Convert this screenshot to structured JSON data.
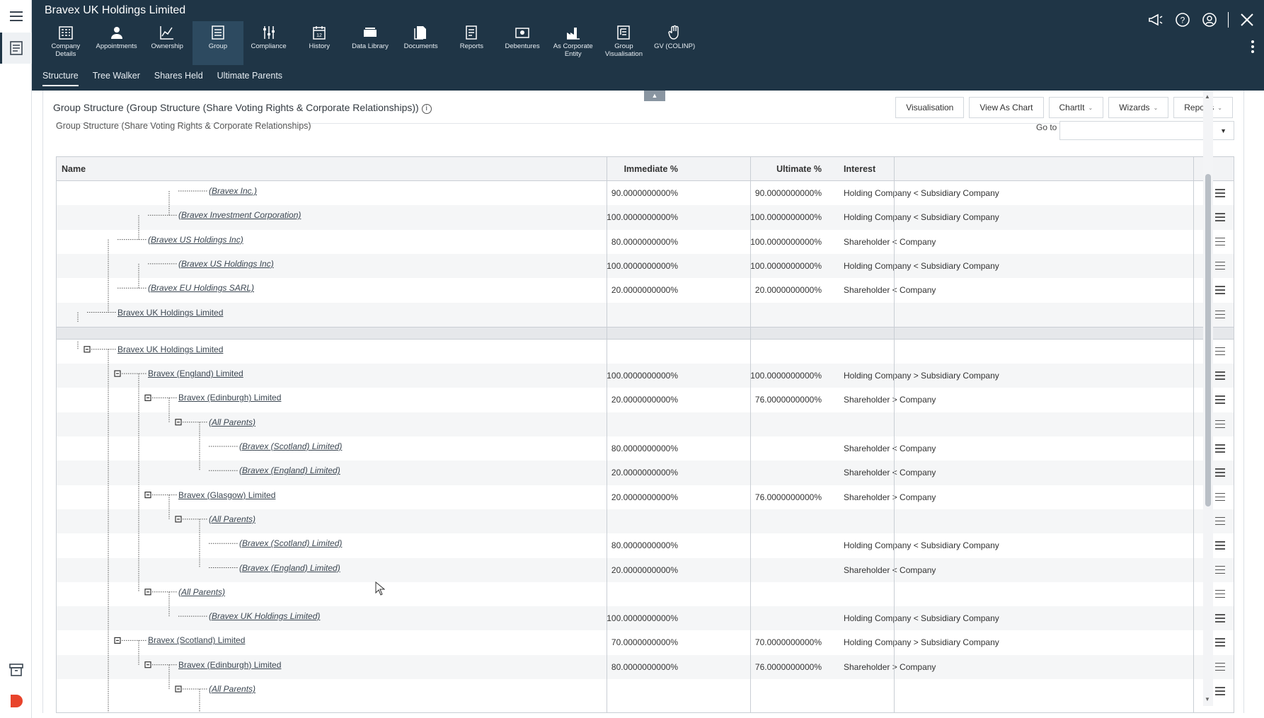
{
  "header": {
    "title": "Bravex UK Holdings Limited"
  },
  "toolbar": [
    {
      "label": "Company Details",
      "icon": "company-details-icon"
    },
    {
      "label": "Appointments",
      "icon": "appointments-icon"
    },
    {
      "label": "Ownership",
      "icon": "ownership-icon"
    },
    {
      "label": "Group",
      "icon": "group-icon",
      "active": true
    },
    {
      "label": "Compliance",
      "icon": "compliance-icon"
    },
    {
      "label": "History",
      "icon": "history-icon"
    },
    {
      "label": "Data Library",
      "icon": "data-library-icon"
    },
    {
      "label": "Documents",
      "icon": "documents-icon"
    },
    {
      "label": "Reports",
      "icon": "reports-icon"
    },
    {
      "label": "Debentures",
      "icon": "debentures-icon"
    },
    {
      "label": "As Corporate Entity",
      "icon": "corporate-entity-icon"
    },
    {
      "label": "Group Visualisation",
      "icon": "group-visualisation-icon"
    },
    {
      "label": "GV (COLINP)",
      "icon": "gv-hand-icon"
    }
  ],
  "subtabs": [
    "Structure",
    "Tree Walker",
    "Shares Held",
    "Ultimate Parents"
  ],
  "panel": {
    "title": "Group Structure (Group Structure (Share Voting Rights & Corporate Relationships))",
    "subtitle": "Group Structure (Share Voting Rights & Corporate Relationships)",
    "goto_label": "Go to",
    "goto_value": "",
    "buttons": {
      "visualisation": "Visualisation",
      "view_as_chart": "View As Chart",
      "chartit": "ChartIt",
      "wizards": "Wizards",
      "reports": "Reports"
    }
  },
  "grid": {
    "columns": {
      "name": "Name",
      "immediate": "Immediate %",
      "ultimate": "Ultimate %",
      "interest": "Interest"
    },
    "upper_rows": [
      {
        "name": "(Bravex Inc.)",
        "italic": true,
        "immediate": "90.0000000000%",
        "ultimate": "90.0000000000%",
        "interest": "Holding Company < Subsidiary Company"
      },
      {
        "name": "(Bravex Investment Corporation)",
        "italic": true,
        "immediate": "100.0000000000%",
        "ultimate": "100.0000000000%",
        "interest": "Holding Company < Subsidiary Company"
      },
      {
        "name": "(Bravex US Holdings Inc)",
        "italic": true,
        "immediate": "80.0000000000%",
        "ultimate": "100.0000000000%",
        "interest": "Shareholder < Company"
      },
      {
        "name": "(Bravex US Holdings Inc)",
        "italic": true,
        "immediate": "100.0000000000%",
        "ultimate": "100.0000000000%",
        "interest": "Holding Company < Subsidiary Company"
      },
      {
        "name": "(Bravex EU Holdings SARL)",
        "italic": true,
        "immediate": "20.0000000000%",
        "ultimate": "20.0000000000%",
        "interest": "Shareholder < Company"
      },
      {
        "name": "Bravex UK Holdings Limited",
        "italic": false,
        "immediate": "",
        "ultimate": "",
        "interest": ""
      }
    ],
    "lower_rows": [
      {
        "name": "Bravex UK Holdings Limited",
        "italic": false,
        "immediate": "",
        "ultimate": "",
        "interest": ""
      },
      {
        "name": "Bravex (England) Limited",
        "italic": false,
        "immediate": "100.0000000000%",
        "ultimate": "100.0000000000%",
        "interest": "Holding Company > Subsidiary Company"
      },
      {
        "name": "Bravex (Edinburgh) Limited",
        "italic": false,
        "immediate": "20.0000000000%",
        "ultimate": "76.0000000000%",
        "interest": "Shareholder > Company"
      },
      {
        "name": "(All Parents)",
        "italic": true,
        "immediate": "",
        "ultimate": "",
        "interest": ""
      },
      {
        "name": "(Bravex (Scotland) Limited)",
        "italic": true,
        "immediate": "80.0000000000%",
        "ultimate": "",
        "interest": "Shareholder < Company"
      },
      {
        "name": "(Bravex (England) Limited)",
        "italic": true,
        "immediate": "20.0000000000%",
        "ultimate": "",
        "interest": "Shareholder < Company"
      },
      {
        "name": "Bravex (Glasgow) Limited",
        "italic": false,
        "immediate": "20.0000000000%",
        "ultimate": "76.0000000000%",
        "interest": "Shareholder > Company"
      },
      {
        "name": "(All Parents)",
        "italic": true,
        "immediate": "",
        "ultimate": "",
        "interest": ""
      },
      {
        "name": "(Bravex (Scotland) Limited)",
        "italic": true,
        "immediate": "80.0000000000%",
        "ultimate": "",
        "interest": "Holding Company < Subsidiary Company"
      },
      {
        "name": "(Bravex (England) Limited)",
        "italic": true,
        "immediate": "20.0000000000%",
        "ultimate": "",
        "interest": "Shareholder < Company"
      },
      {
        "name": "(All Parents)",
        "italic": true,
        "immediate": "",
        "ultimate": "",
        "interest": ""
      },
      {
        "name": "(Bravex UK Holdings Limited)",
        "italic": true,
        "immediate": "100.0000000000%",
        "ultimate": "",
        "interest": "Holding Company < Subsidiary Company"
      },
      {
        "name": "Bravex (Scotland) Limited",
        "italic": false,
        "immediate": "70.0000000000%",
        "ultimate": "70.0000000000%",
        "interest": "Holding Company > Subsidiary Company"
      },
      {
        "name": "Bravex (Edinburgh) Limited",
        "italic": false,
        "immediate": "80.0000000000%",
        "ultimate": "76.0000000000%",
        "interest": "Shareholder > Company"
      },
      {
        "name": "(All Parents)",
        "italic": true,
        "immediate": "",
        "ultimate": "",
        "interest": ""
      }
    ]
  }
}
